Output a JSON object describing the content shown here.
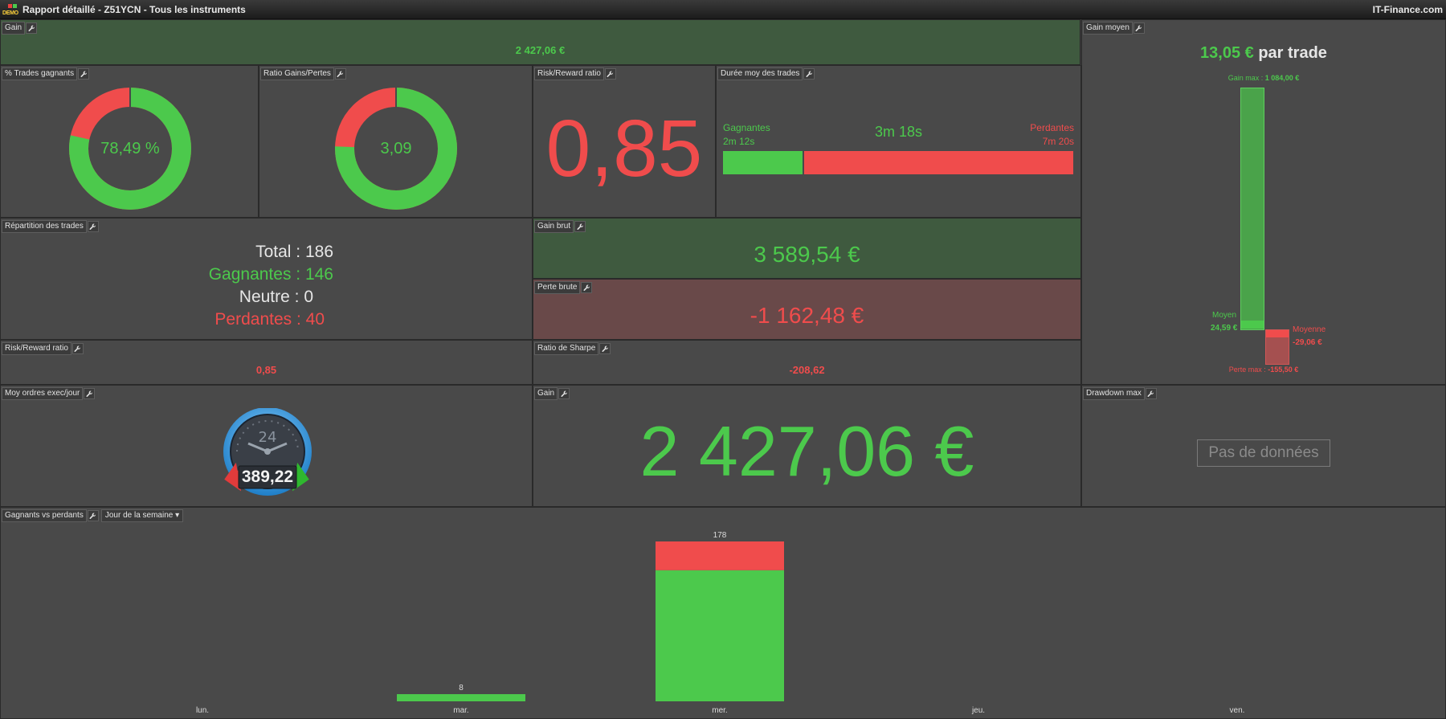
{
  "window": {
    "title": "Rapport détaillé - Z51YCN - Tous les instruments",
    "brand": "IT-Finance.com",
    "logo_text": "DEMO"
  },
  "colors": {
    "green": "#4cc94c",
    "red": "#f04c4c",
    "panel": "#494949"
  },
  "gain_top": {
    "title": "Gain",
    "value": "2 427,06 €"
  },
  "pct_trades": {
    "title": "% Trades gagnants",
    "value": "78,49 %",
    "win_fraction": 0.7849
  },
  "ratio_gp": {
    "title": "Ratio Gains/Pertes",
    "value": "3,09",
    "win_fraction": 0.7555
  },
  "risk_reward_big": {
    "title": "Risk/Reward ratio",
    "value": "0,85"
  },
  "duree": {
    "title": "Durée moy des trades",
    "win_label": "Gagnantes",
    "win_time": "2m 12s",
    "avg_time": "3m 18s",
    "loss_label": "Perdantes",
    "loss_time": "7m 20s",
    "win_fraction": 0.231
  },
  "gain_moyen": {
    "title": "Gain moyen",
    "value": "13,05 €",
    "suffix": "par trade",
    "gain_max_label": "Gain max :",
    "gain_max": "1 084,00 €",
    "moyen_label": "Moyen",
    "moyen_value": "24,59 €",
    "moyenne_label": "Moyenne",
    "moyenne_value": "-29,06 €",
    "perte_max_label": "Perte max :",
    "perte_max": "-155,50 €"
  },
  "repartition": {
    "title": "Répartition des trades",
    "total": "Total : 186",
    "gagnantes": "Gagnantes : 146",
    "neutre": "Neutre : 0",
    "perdantes": "Perdantes : 40"
  },
  "gain_brut": {
    "title": "Gain brut",
    "value": "3 589,54 €"
  },
  "perte_brute": {
    "title": "Perte brute",
    "value": "-1 162,48 €"
  },
  "risk_reward_small": {
    "title": "Risk/Reward ratio",
    "value": "0,85"
  },
  "sharpe": {
    "title": "Ratio de Sharpe",
    "value": "-208,62"
  },
  "moy_ordres": {
    "title": "Moy ordres exec/jour",
    "value": "389,22",
    "dial_label": "24"
  },
  "gain_big": {
    "title": "Gain",
    "value": "2 427,06 €"
  },
  "drawdown": {
    "title": "Drawdown max",
    "empty": "Pas de données"
  },
  "gvp": {
    "title": "Gagnants vs perdants",
    "dropdown": "Jour de la semaine"
  },
  "chart_data": {
    "type": "bar",
    "stacked": true,
    "categories": [
      "lun.",
      "mar.",
      "mer.",
      "jeu.",
      "ven."
    ],
    "totals": [
      0,
      8,
      178,
      0,
      0
    ],
    "total_labels": [
      "",
      "8",
      "178",
      "",
      ""
    ],
    "series": [
      {
        "color": "#4cc94c",
        "values": [
          0,
          8,
          146,
          0,
          0
        ]
      },
      {
        "color": "#f04c4c",
        "values": [
          0,
          0,
          32,
          0,
          0
        ]
      }
    ],
    "ylim": [
      0,
      178
    ],
    "grid": false
  }
}
